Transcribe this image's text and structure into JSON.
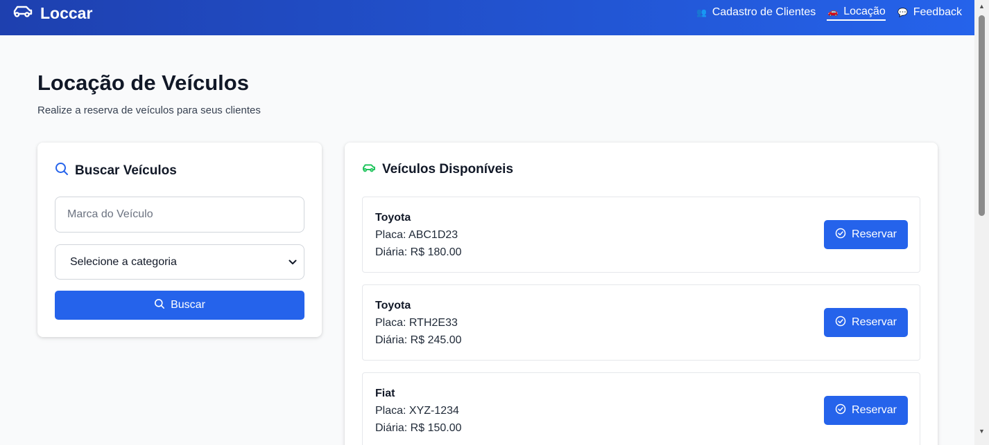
{
  "colors": {
    "nav_start": "#1e40af",
    "nav_end": "#2563eb",
    "primary": "#2563eb",
    "search_icon": "#2563eb",
    "car_icon": "#22c55e"
  },
  "nav": {
    "brand": "Loccar",
    "brand_icon": "car-icon",
    "links": [
      {
        "emoji": "👥",
        "label": "Cadastro de Clientes",
        "active": false
      },
      {
        "emoji": "🚗",
        "label": "Locação",
        "active": true
      },
      {
        "emoji": "💬",
        "label": "Feedback",
        "active": false
      }
    ]
  },
  "page": {
    "title": "Locação de Veículos",
    "subtitle": "Realize a reserva de veículos para seus clientes"
  },
  "search": {
    "title": "Buscar Veículos",
    "icon": "search-icon",
    "brand_placeholder": "Marca do Veículo",
    "brand_value": "",
    "category_selected": "Selecione a categoria",
    "button_label": "Buscar"
  },
  "vehicles": {
    "title": "Veículos Disponíveis",
    "icon": "car-icon",
    "items": [
      {
        "brand": "Toyota",
        "plate": "Placa: ABC1D23",
        "rate": "Diária: R$ 180.00",
        "button": "Reservar"
      },
      {
        "brand": "Toyota",
        "plate": "Placa: RTH2E33",
        "rate": "Diária: R$ 245.00",
        "button": "Reservar"
      },
      {
        "brand": "Fiat",
        "plate": "Placa: XYZ-1234",
        "rate": "Diária: R$ 150.00",
        "button": "Reservar"
      }
    ]
  }
}
